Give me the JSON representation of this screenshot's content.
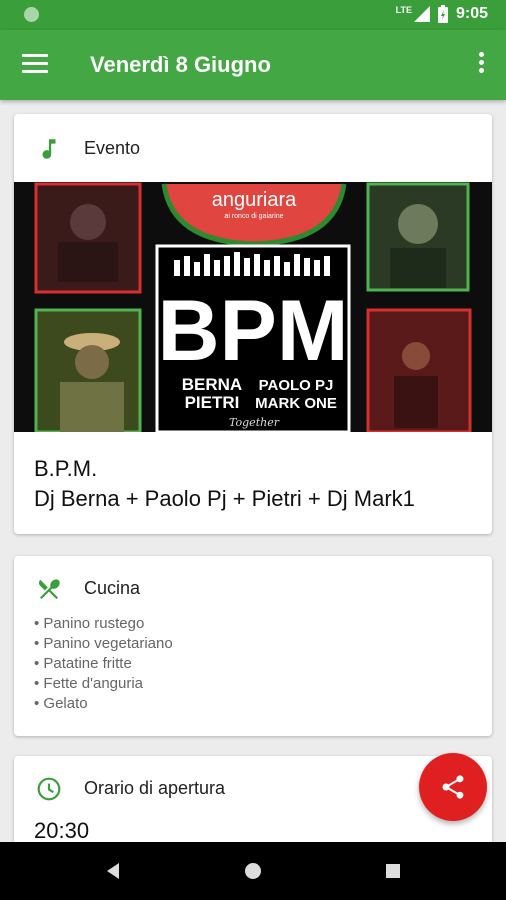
{
  "status": {
    "time": "9:05",
    "network": "LTE"
  },
  "appbar": {
    "title": "Venerdì 8 Giugno"
  },
  "event": {
    "header": "Evento",
    "poster": {
      "brand": "anguriara",
      "subbrand": "ai ronco di gaiarine",
      "big": "BPM",
      "line1_left": "BERNA",
      "line1_right": "PAOLO PJ",
      "line2_left": "PIETRI",
      "line2_right": "MARK ONE",
      "tagline": "Together"
    },
    "title": "B.P.M.",
    "subtitle": "Dj Berna + Paolo Pj + Pietri + Dj Mark1"
  },
  "kitchen": {
    "header": "Cucina",
    "items": [
      "Panino rustego",
      "Panino vegetariano",
      "Patatine fritte",
      "Fette d'anguria",
      "Gelato"
    ]
  },
  "hours": {
    "header": "Orario di apertura",
    "time": "20:30"
  },
  "colors": {
    "primary": "#43a843",
    "status": "#3a9e3a",
    "fab": "#e02020",
    "icon": "#3a9e3a"
  }
}
